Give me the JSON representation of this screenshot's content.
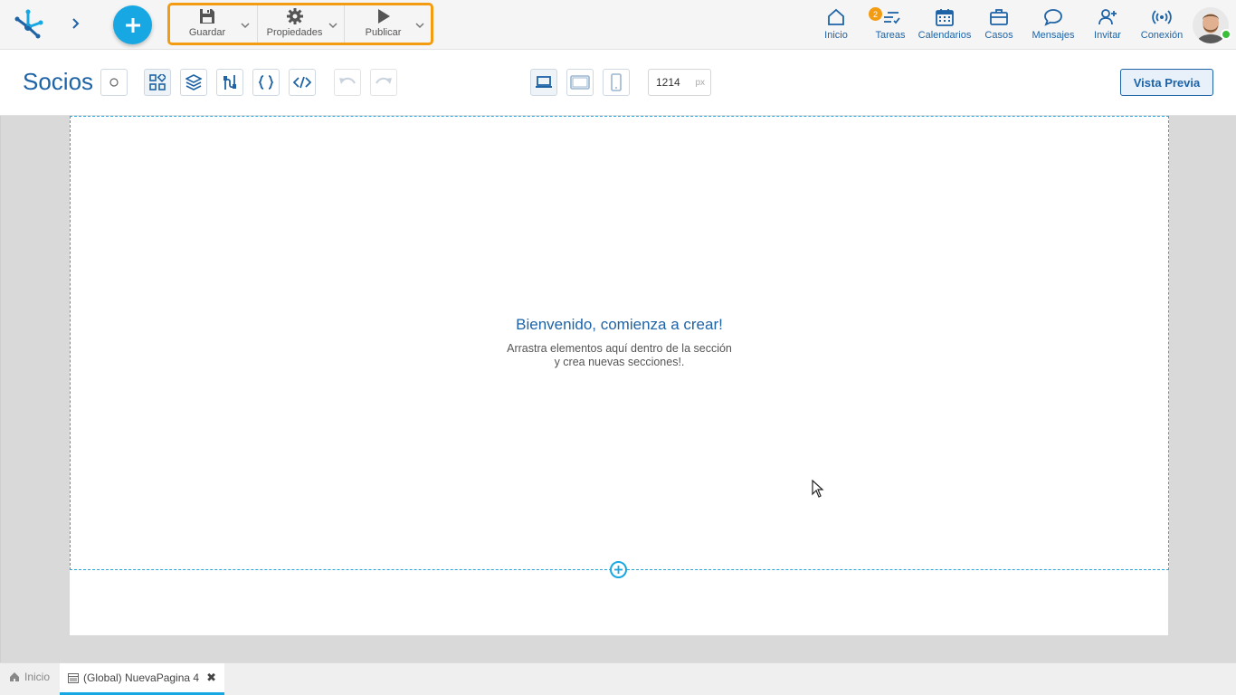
{
  "topbar": {
    "actions": {
      "save": "Guardar",
      "properties": "Propiedades",
      "publish": "Publicar"
    },
    "nav": {
      "home": "Inicio",
      "tasks": "Tareas",
      "tasks_badge": "2",
      "calendars": "Calendarios",
      "cases": "Casos",
      "messages": "Mensajes",
      "invite": "Invitar",
      "connection": "Conexión"
    },
    "accent_color": "#17a8e3",
    "highlight_color": "#f39c12"
  },
  "toolbar": {
    "title": "Socios",
    "width_value": "1214",
    "width_unit": "px",
    "preview_label": "Vista Previa"
  },
  "canvas": {
    "welcome_title": "Bienvenido, comienza a crear!",
    "welcome_line1": "Arrastra elementos aquí dentro de la sección",
    "welcome_line2": "y crea nuevas secciones!."
  },
  "bottombar": {
    "home_tab": "Inicio",
    "page_tab": "(Global) NuevaPagina 4"
  }
}
